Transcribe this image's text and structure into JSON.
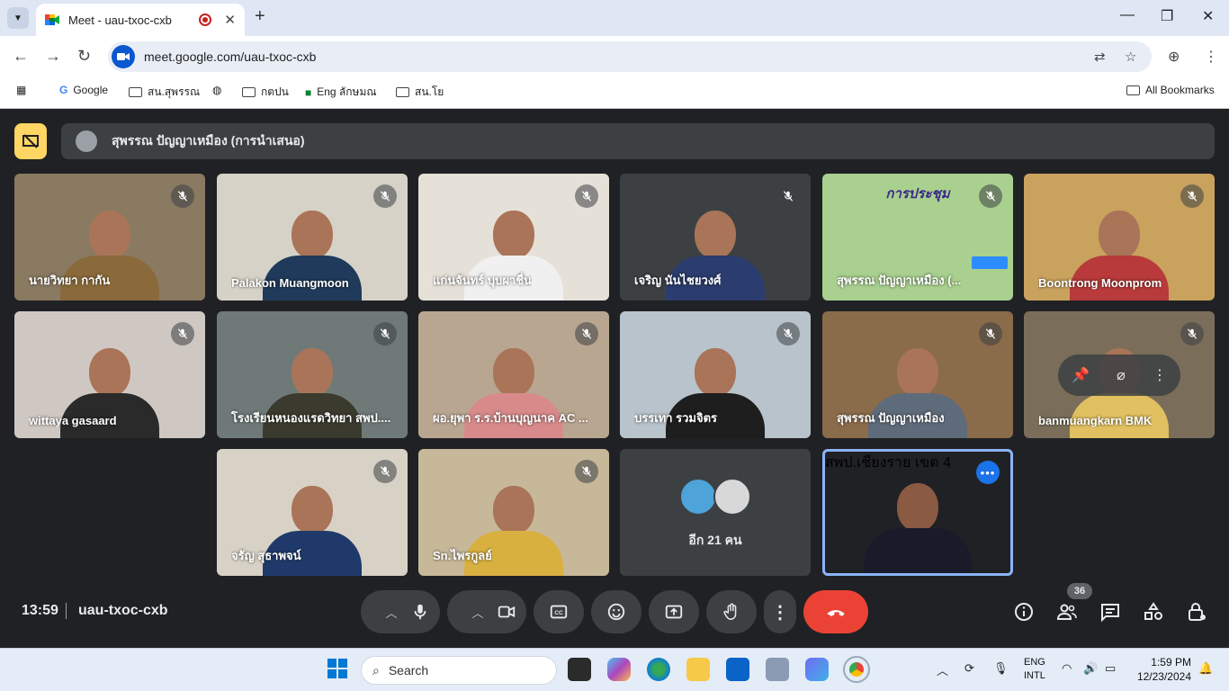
{
  "browser": {
    "tab_title": "Meet - uau-txoc-cxb",
    "url": "meet.google.com/uau-txoc-cxb",
    "bookmarks": [
      "Google",
      "สน.สุพรรณ",
      "กตปน",
      "Eng ลักษมณ",
      "สน.โย"
    ],
    "all_bookmarks": "All Bookmarks"
  },
  "meet": {
    "presenter_label": "สุพรรณ ปัญญาเหมือง (การนำเสนอ)",
    "tiles": [
      {
        "name": "นายวิทยา กากัน",
        "bg": "#8a7a62",
        "shirt": "#8a6a3a"
      },
      {
        "name": "Palakon Muangmoon",
        "bg": "#d6d2c8",
        "shirt": "#1f3a5a"
      },
      {
        "name": "แก่นจันทร์ บุบผาชื่น",
        "bg": "#e6e1d8",
        "shirt": "#f0f0f0"
      },
      {
        "name": "เจริญ นันไชยวงศ์",
        "bg": "#3c4043",
        "shirt": "#2b3c6e"
      },
      {
        "name": "สุพรรณ ปัญญาเหมือง (...",
        "bg": "#a9d08e",
        "shirt": "#a9d08e",
        "slide_title": "การประชุม"
      },
      {
        "name": "Boontrong Moonprom",
        "bg": "#c9a25e",
        "shirt": "#b83a3a"
      },
      {
        "name": "wittaya gasaard",
        "bg": "#cfc8c2",
        "shirt": "#2a2a2a"
      },
      {
        "name": "โรงเรียนหนองแรดวิทยา สพป....",
        "bg": "#6f7a78",
        "shirt": "#3a3a2e"
      },
      {
        "name": "ผอ.ยุพา ร.ร.บ้านบุญนาค AC ...",
        "bg": "#b9a691",
        "shirt": "#d88a8a"
      },
      {
        "name": "บรรเทา รวมจิตร",
        "bg": "#b8c3cc",
        "shirt": "#1e1e1e"
      },
      {
        "name": "สุพรรณ ปัญญาเหมือง",
        "bg": "#8a6b4a",
        "shirt": "#5e6b7a"
      },
      {
        "name": "banmuangkarn BMK",
        "bg": "#7a6e5a",
        "shirt": "#e0c060"
      },
      {
        "name": "จรัญ สุธาพจน์",
        "bg": "#d8d2c6",
        "shirt": "#1f3a6a"
      },
      {
        "name": "Sn.ไพรกูลย์",
        "bg": "#c7b89a",
        "shirt": "#d8b040"
      }
    ],
    "more_label": "อีก 21 คน",
    "active_name": "สพป.เชียงราย เขต 4",
    "time": "13:59",
    "meeting_code": "uau-txoc-cxb",
    "participants_count": "36",
    "colors": {
      "end_call": "#ea4335",
      "accent": "#8ab4f8",
      "present": "#fdd663"
    }
  },
  "taskbar": {
    "search_placeholder": "Search",
    "lang_line1": "ENG",
    "lang_line2": "INTL",
    "clock_time": "1:59 PM",
    "clock_date": "12/23/2024"
  }
}
